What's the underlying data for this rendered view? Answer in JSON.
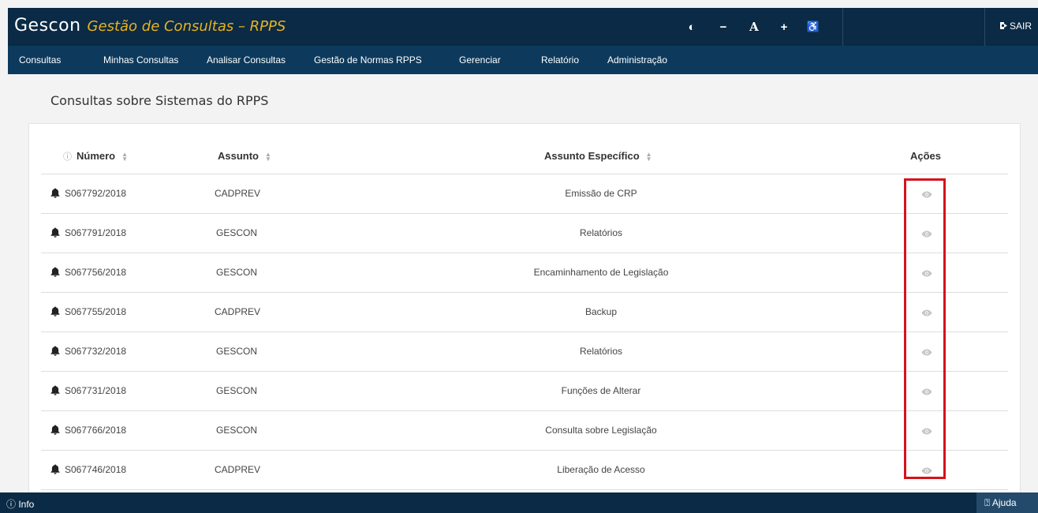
{
  "header": {
    "brand": "Gescon",
    "subtitle": "Gestão de Consultas – RPPS",
    "accessibility": {
      "contrast": "◐",
      "decrease": "−",
      "font": "A",
      "increase": "+",
      "a11y": "♿"
    },
    "logout_label": "SAIR"
  },
  "nav": [
    "Consultas",
    "Minhas Consultas",
    "Analisar Consultas",
    "Gestão de Normas RPPS",
    "Gerenciar",
    "Relatório",
    "Administração"
  ],
  "page": {
    "title": "Consultas sobre Sistemas do RPPS"
  },
  "table": {
    "columns": {
      "numero": "Número",
      "assunto": "Assunto",
      "especifico": "Assunto Específico",
      "acoes": "Ações"
    },
    "rows": [
      {
        "numero": "S067792/2018",
        "assunto": "CADPREV",
        "especifico": "Emissão de CRP"
      },
      {
        "numero": "S067791/2018",
        "assunto": "GESCON",
        "especifico": "Relatórios"
      },
      {
        "numero": "S067756/2018",
        "assunto": "GESCON",
        "especifico": "Encaminhamento de Legislação"
      },
      {
        "numero": "S067755/2018",
        "assunto": "CADPREV",
        "especifico": "Backup"
      },
      {
        "numero": "S067732/2018",
        "assunto": "GESCON",
        "especifico": "Relatórios"
      },
      {
        "numero": "S067731/2018",
        "assunto": "GESCON",
        "especifico": "Funções de Alterar"
      },
      {
        "numero": "S067766/2018",
        "assunto": "GESCON",
        "especifico": "Consulta sobre Legislação"
      },
      {
        "numero": "S067746/2018",
        "assunto": "CADPREV",
        "especifico": "Liberação de Acesso"
      }
    ]
  },
  "footer": {
    "info_label": "Info",
    "help_label": "Ajuda"
  },
  "colors": {
    "header_bg": "#0a2a45",
    "nav_bg": "#0d3a5c",
    "brand_accent": "#e8b31e",
    "highlight": "#d4121c"
  }
}
